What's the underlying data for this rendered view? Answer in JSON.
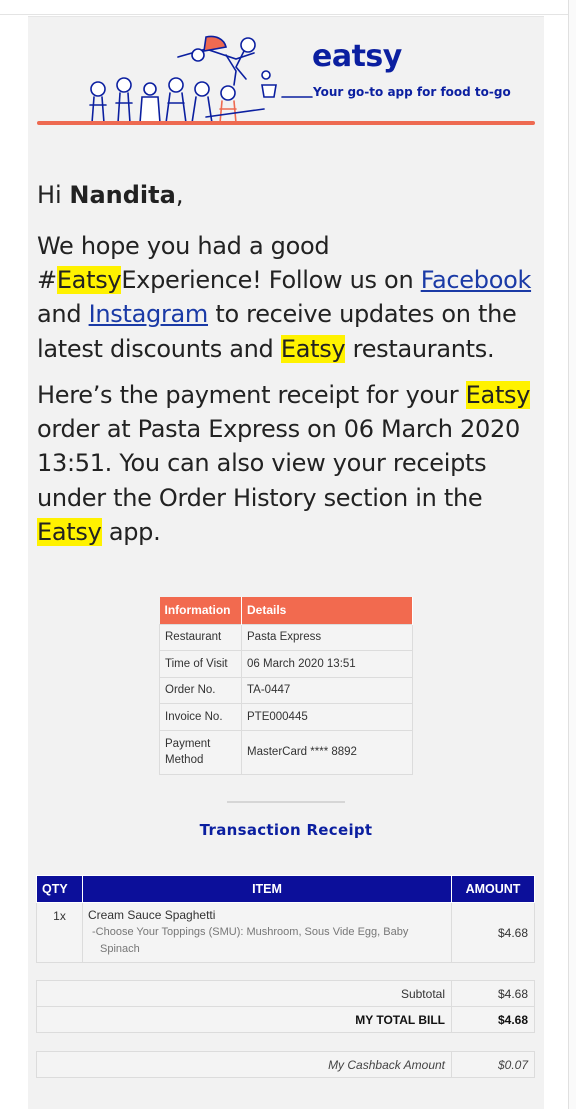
{
  "header": {
    "brand": "eatsy",
    "tagline": "Your go-to app for food to-go",
    "accent_color": "#ee6a51",
    "brand_color": "#0b1fa0"
  },
  "greeting": {
    "hi": "Hi",
    "name": "Nandita",
    "comma": ","
  },
  "para1": {
    "t1": "We hope you had a good #",
    "hl1": "Eatsy",
    "t2": "Experience! Follow us on ",
    "link_facebook": "Facebook",
    "t3": " and ",
    "link_instagram": "Instagram",
    "t4": " to receive updates on the latest discounts and ",
    "hl2": "Eatsy",
    "t5": " restaurants."
  },
  "para2": {
    "t1": "Here’s the payment receipt for your ",
    "hl1": "Eatsy",
    "t2": " order at Pasta Express on 06 March 2020 13:51. You can also view your receipts under the Order History section in the ",
    "hl2": "Eatsy",
    "t3": " app."
  },
  "info_table": {
    "headers": [
      "Information",
      "Details"
    ],
    "rows": [
      {
        "key": "Restaurant",
        "value": "Pasta Express"
      },
      {
        "key": "Time of Visit",
        "value": "06 March 2020 13:51"
      },
      {
        "key": "Order No.",
        "value": "TA-0447"
      },
      {
        "key": "Invoice No.",
        "value": "PTE000445"
      },
      {
        "key": "Payment Method",
        "value": "MasterCard **** 8892"
      }
    ]
  },
  "receipt": {
    "title": "Transaction Receipt",
    "headers": {
      "qty": "QTY",
      "item": "ITEM",
      "amount": "AMOUNT"
    },
    "items": [
      {
        "qty": "1x",
        "name": "Cream Sauce Spaghetti",
        "option_line1": "-Choose Your Toppings (SMU): Mushroom, Sous Vide Egg, Baby",
        "option_line2": "Spinach",
        "amount": "$4.68"
      }
    ],
    "subtotal_label": "Subtotal",
    "subtotal_value": "$4.68",
    "total_label": "MY TOTAL BILL",
    "total_value": "$4.68",
    "cashback_label": "My Cashback Amount",
    "cashback_value": "$0.07"
  }
}
